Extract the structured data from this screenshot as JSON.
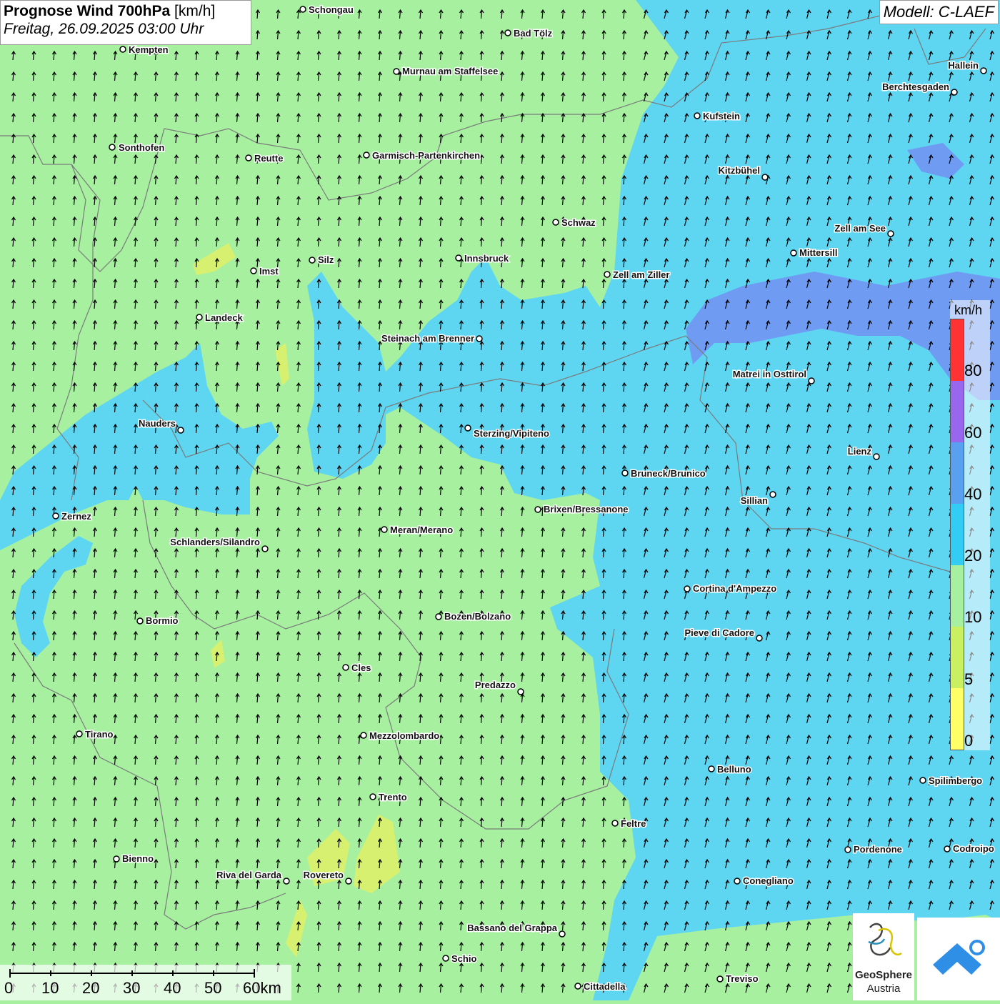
{
  "header": {
    "title_bold": "Prognose Wind 700hPa",
    "title_unit": "[km/h]",
    "datetime": "Freitag, 26.09.2025 03:00 Uhr",
    "model": "Modell: C-LAEF"
  },
  "legend": {
    "unit": "km/h",
    "ticks": [
      "0",
      "5",
      "10",
      "20",
      "40",
      "60",
      "80"
    ],
    "colors": [
      "#ffff66",
      "#c8f060",
      "#a6f0a0",
      "#33ccf5",
      "#5aa0f0",
      "#9966ee",
      "#ff3333"
    ]
  },
  "map_colors": {
    "calm": "#a6f0a0",
    "moderate": "#5ed6f2",
    "fresh": "#6f9cf2",
    "weak": "#d8f070"
  },
  "cities": [
    {
      "name": "Schongau"
    },
    {
      "name": "Bad Tölz"
    },
    {
      "name": "Kempten"
    },
    {
      "name": "Murnau am Staffelsee"
    },
    {
      "name": "Hallein"
    },
    {
      "name": "Berchtesgaden"
    },
    {
      "name": "Kufstein"
    },
    {
      "name": "Sonthofen"
    },
    {
      "name": "Reutte"
    },
    {
      "name": "Garmisch-Partenkirchen"
    },
    {
      "name": "Kitzbühel"
    },
    {
      "name": "Schwaz"
    },
    {
      "name": "Zell am See"
    },
    {
      "name": "Mittersill"
    },
    {
      "name": "Innsbruck"
    },
    {
      "name": "Silz"
    },
    {
      "name": "Imst"
    },
    {
      "name": "Zell am Ziller"
    },
    {
      "name": "Landeck"
    },
    {
      "name": "Steinach am Brenner"
    },
    {
      "name": "Matrei in Osttirol"
    },
    {
      "name": "Nauders"
    },
    {
      "name": "Sterzing/Vipiteno"
    },
    {
      "name": "Lienz"
    },
    {
      "name": "Bruneck/Brunico"
    },
    {
      "name": "Sillian"
    },
    {
      "name": "Brixen/Bressanone"
    },
    {
      "name": "Zernez"
    },
    {
      "name": "Meran/Merano"
    },
    {
      "name": "Schlanders/Silandro"
    },
    {
      "name": "Cortina d'Ampezzo"
    },
    {
      "name": "Bozen/Bolzano"
    },
    {
      "name": "Bormio"
    },
    {
      "name": "Pieve di Cadore"
    },
    {
      "name": "Cles"
    },
    {
      "name": "Predazzo"
    },
    {
      "name": "Tirano"
    },
    {
      "name": "Mezzolombardo"
    },
    {
      "name": "Belluno"
    },
    {
      "name": "Spilimbergo"
    },
    {
      "name": "Trento"
    },
    {
      "name": "Feltre"
    },
    {
      "name": "Bienno"
    },
    {
      "name": "Pordenone"
    },
    {
      "name": "Codroipo"
    },
    {
      "name": "Riva del Garda"
    },
    {
      "name": "Rovereto"
    },
    {
      "name": "Conegliano"
    },
    {
      "name": "Bassano del Grappa"
    },
    {
      "name": "Schio"
    },
    {
      "name": "Treviso"
    },
    {
      "name": "Cittadella"
    }
  ],
  "scale_bar": {
    "labels": [
      "0",
      "10",
      "20",
      "30",
      "40",
      "50",
      "60km"
    ]
  },
  "logos": {
    "brand_line1": "GeoSphere",
    "brand_line2": "Austria"
  }
}
